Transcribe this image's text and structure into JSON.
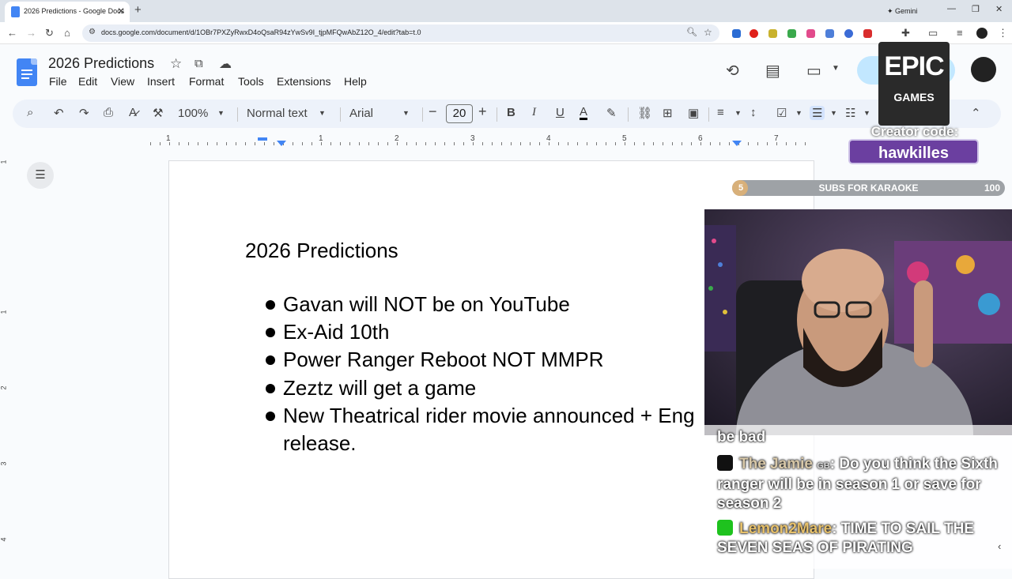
{
  "browser": {
    "tab_title": "2026 Predictions - Google Docs",
    "tab_close": "✕",
    "new_tab": "+",
    "gemini_label": "Gemini",
    "url": "docs.google.com/document/d/1OBr7PXZyRwxD4oQsaR94zYwSv9I_tjpMFQwAbZ12O_4/edit?tab=t.0"
  },
  "docs": {
    "title": "2026 Predictions",
    "menu": [
      "File",
      "Edit",
      "View",
      "Insert",
      "Format",
      "Tools",
      "Extensions",
      "Help"
    ],
    "toolbar": {
      "zoom": "100%",
      "style": "Normal text",
      "font": "Arial",
      "font_size": "20"
    },
    "ruler_numbers": [
      "1",
      "1",
      "2",
      "3",
      "4",
      "5",
      "6",
      "7"
    ],
    "vruler_numbers": [
      "1",
      "1",
      "2",
      "3",
      "4"
    ]
  },
  "document": {
    "heading": "2026 Predictions",
    "bullets": [
      "Gavan will NOT be on YouTube",
      "Ex-Aid 10th",
      "Power Ranger Reboot NOT MMPR",
      "Zeztz will get a game",
      "New Theatrical rider movie announced + Eng",
      "release."
    ]
  },
  "stream": {
    "epic_line1": "EPIC",
    "epic_line2": "GAMES",
    "creator_label": "Creator code:",
    "creator_code": "hawkilles",
    "goal": {
      "current": "5",
      "label": "SUBS FOR KARAOKE",
      "target": "100",
      "progress": 0.05
    },
    "chat": [
      {
        "user": "",
        "text": "be bad"
      },
      {
        "user": "The Jamie",
        "badge": "GB",
        "text": ": Do you think the Sixth ranger will be in season 1 or save for season 2"
      },
      {
        "user": "Lemon2Mare",
        "badge": "",
        "text": ": TIME TO SAIL THE SEVEN SEAS OF PIRATING"
      }
    ]
  },
  "colors": {
    "docs_blue": "#4285f4",
    "toolbar_bg": "#edf2fa",
    "share_bg": "#c2e7ff",
    "creator_purple": "#6b3fa0"
  }
}
